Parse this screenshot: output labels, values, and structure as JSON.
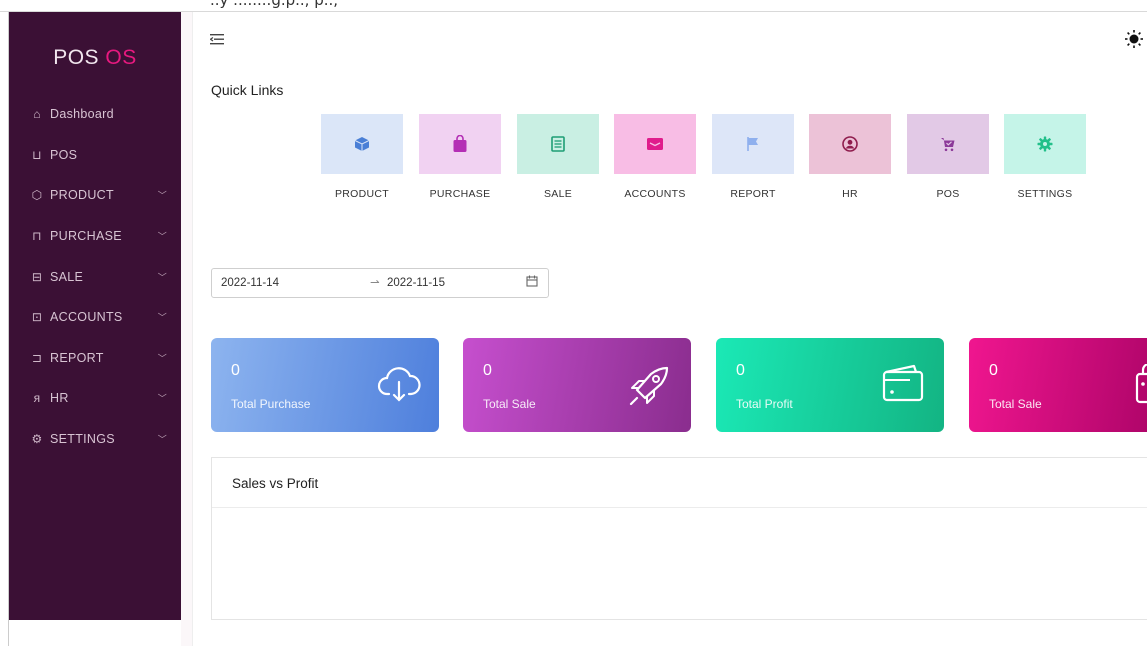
{
  "app": {
    "logo_main": "POS",
    "logo_accent": "OS"
  },
  "topstrip": {
    "text": "..y ........g.p.., p..,"
  },
  "sidebar": {
    "items": [
      {
        "label": "Dashboard",
        "icon": "home-icon",
        "has_children": false
      },
      {
        "label": "POS",
        "icon": "cart-icon",
        "has_children": false
      },
      {
        "label": "PRODUCT",
        "icon": "box-icon",
        "has_children": true
      },
      {
        "label": "PURCHASE",
        "icon": "bag-icon",
        "has_children": true
      },
      {
        "label": "SALE",
        "icon": "receipt-icon",
        "has_children": true
      },
      {
        "label": "ACCOUNTS",
        "icon": "wallet-icon",
        "has_children": true
      },
      {
        "label": "REPORT",
        "icon": "report-icon",
        "has_children": true
      },
      {
        "label": "HR",
        "icon": "user-icon",
        "has_children": true
      },
      {
        "label": "SETTINGS",
        "icon": "gear-icon",
        "has_children": true
      }
    ]
  },
  "quick_links": {
    "title": "Quick Links",
    "items": [
      {
        "label": "PRODUCT",
        "icon": "box-icon",
        "bg": "#dbe6f8",
        "fg": "#4a7fd6"
      },
      {
        "label": "PURCHASE",
        "icon": "bag-icon",
        "bg": "#f1d2f2",
        "fg": "#b42fb5"
      },
      {
        "label": "SALE",
        "icon": "receipt-icon",
        "bg": "#c9efe3",
        "fg": "#1e9e75"
      },
      {
        "label": "ACCOUNTS",
        "icon": "wallet-icon",
        "bg": "#f8bde5",
        "fg": "#e01c8c"
      },
      {
        "label": "REPORT",
        "icon": "flag-icon",
        "bg": "#dde6f8",
        "fg": "#8fb0ee"
      },
      {
        "label": "HR",
        "icon": "user-circle-icon",
        "bg": "#ecc2d7",
        "fg": "#8f1c4d"
      },
      {
        "label": "POS",
        "icon": "cart-icon",
        "bg": "#e2c9e6",
        "fg": "#8c3a99"
      },
      {
        "label": "SETTINGS",
        "icon": "gear-icon",
        "bg": "#c5f4e8",
        "fg": "#22c08a"
      }
    ]
  },
  "date_range": {
    "start": "2022-11-14",
    "end": "2022-11-15"
  },
  "stats": [
    {
      "value": "0",
      "label": "Total Purchase",
      "icon": "cloud-download-icon",
      "gradient": [
        "#8db4ef",
        "#4e7fdc"
      ]
    },
    {
      "value": "0",
      "label": "Total Sale",
      "icon": "rocket-icon",
      "gradient": [
        "#c64fce",
        "#8a2d8e"
      ]
    },
    {
      "value": "0",
      "label": "Total Profit",
      "icon": "wallet-icon",
      "gradient": [
        "#1be9b6",
        "#13b483"
      ]
    },
    {
      "value": "0",
      "label": "Total Sale",
      "icon": "bag-icon",
      "gradient": [
        "#f0168f",
        "#b0056a"
      ]
    }
  ],
  "chart_panel": {
    "title": "Sales vs Profit"
  }
}
